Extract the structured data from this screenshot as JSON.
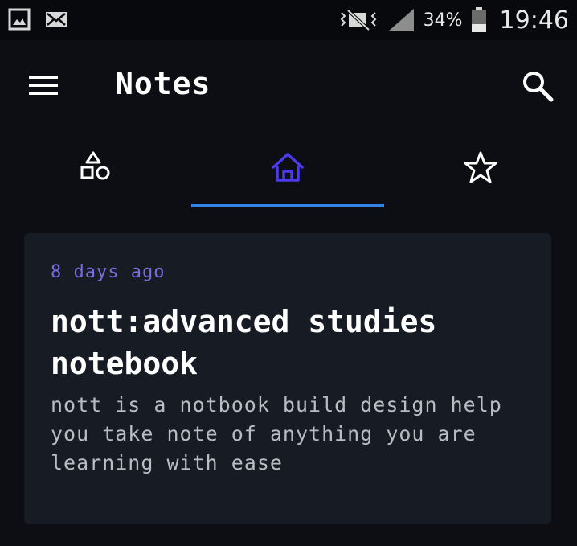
{
  "status_bar": {
    "left_icons": [
      "image-icon",
      "mail-icon"
    ],
    "right_icons": [
      "vibrate-icon",
      "signal-icon",
      "battery-icon"
    ],
    "battery_percent": "34%",
    "time": "19:46"
  },
  "app_bar": {
    "title": "Notes",
    "menu_icon": "menu-icon",
    "search_icon": "search-icon"
  },
  "tabs": [
    {
      "icon": "shapes-icon",
      "active": false
    },
    {
      "icon": "home-icon",
      "active": true
    },
    {
      "icon": "star-icon",
      "active": false
    }
  ],
  "colors": {
    "background": "#0c0e13",
    "card": "#161b24",
    "accent": "#2f86e8",
    "active_icon": "#4b3bea",
    "date_text": "#7a6ce0"
  },
  "notes": [
    {
      "date": "8 days ago",
      "title": "nott:advanced studies notebook",
      "body": "nott is a notbook build design help you take note of anything you are learning with ease"
    }
  ]
}
